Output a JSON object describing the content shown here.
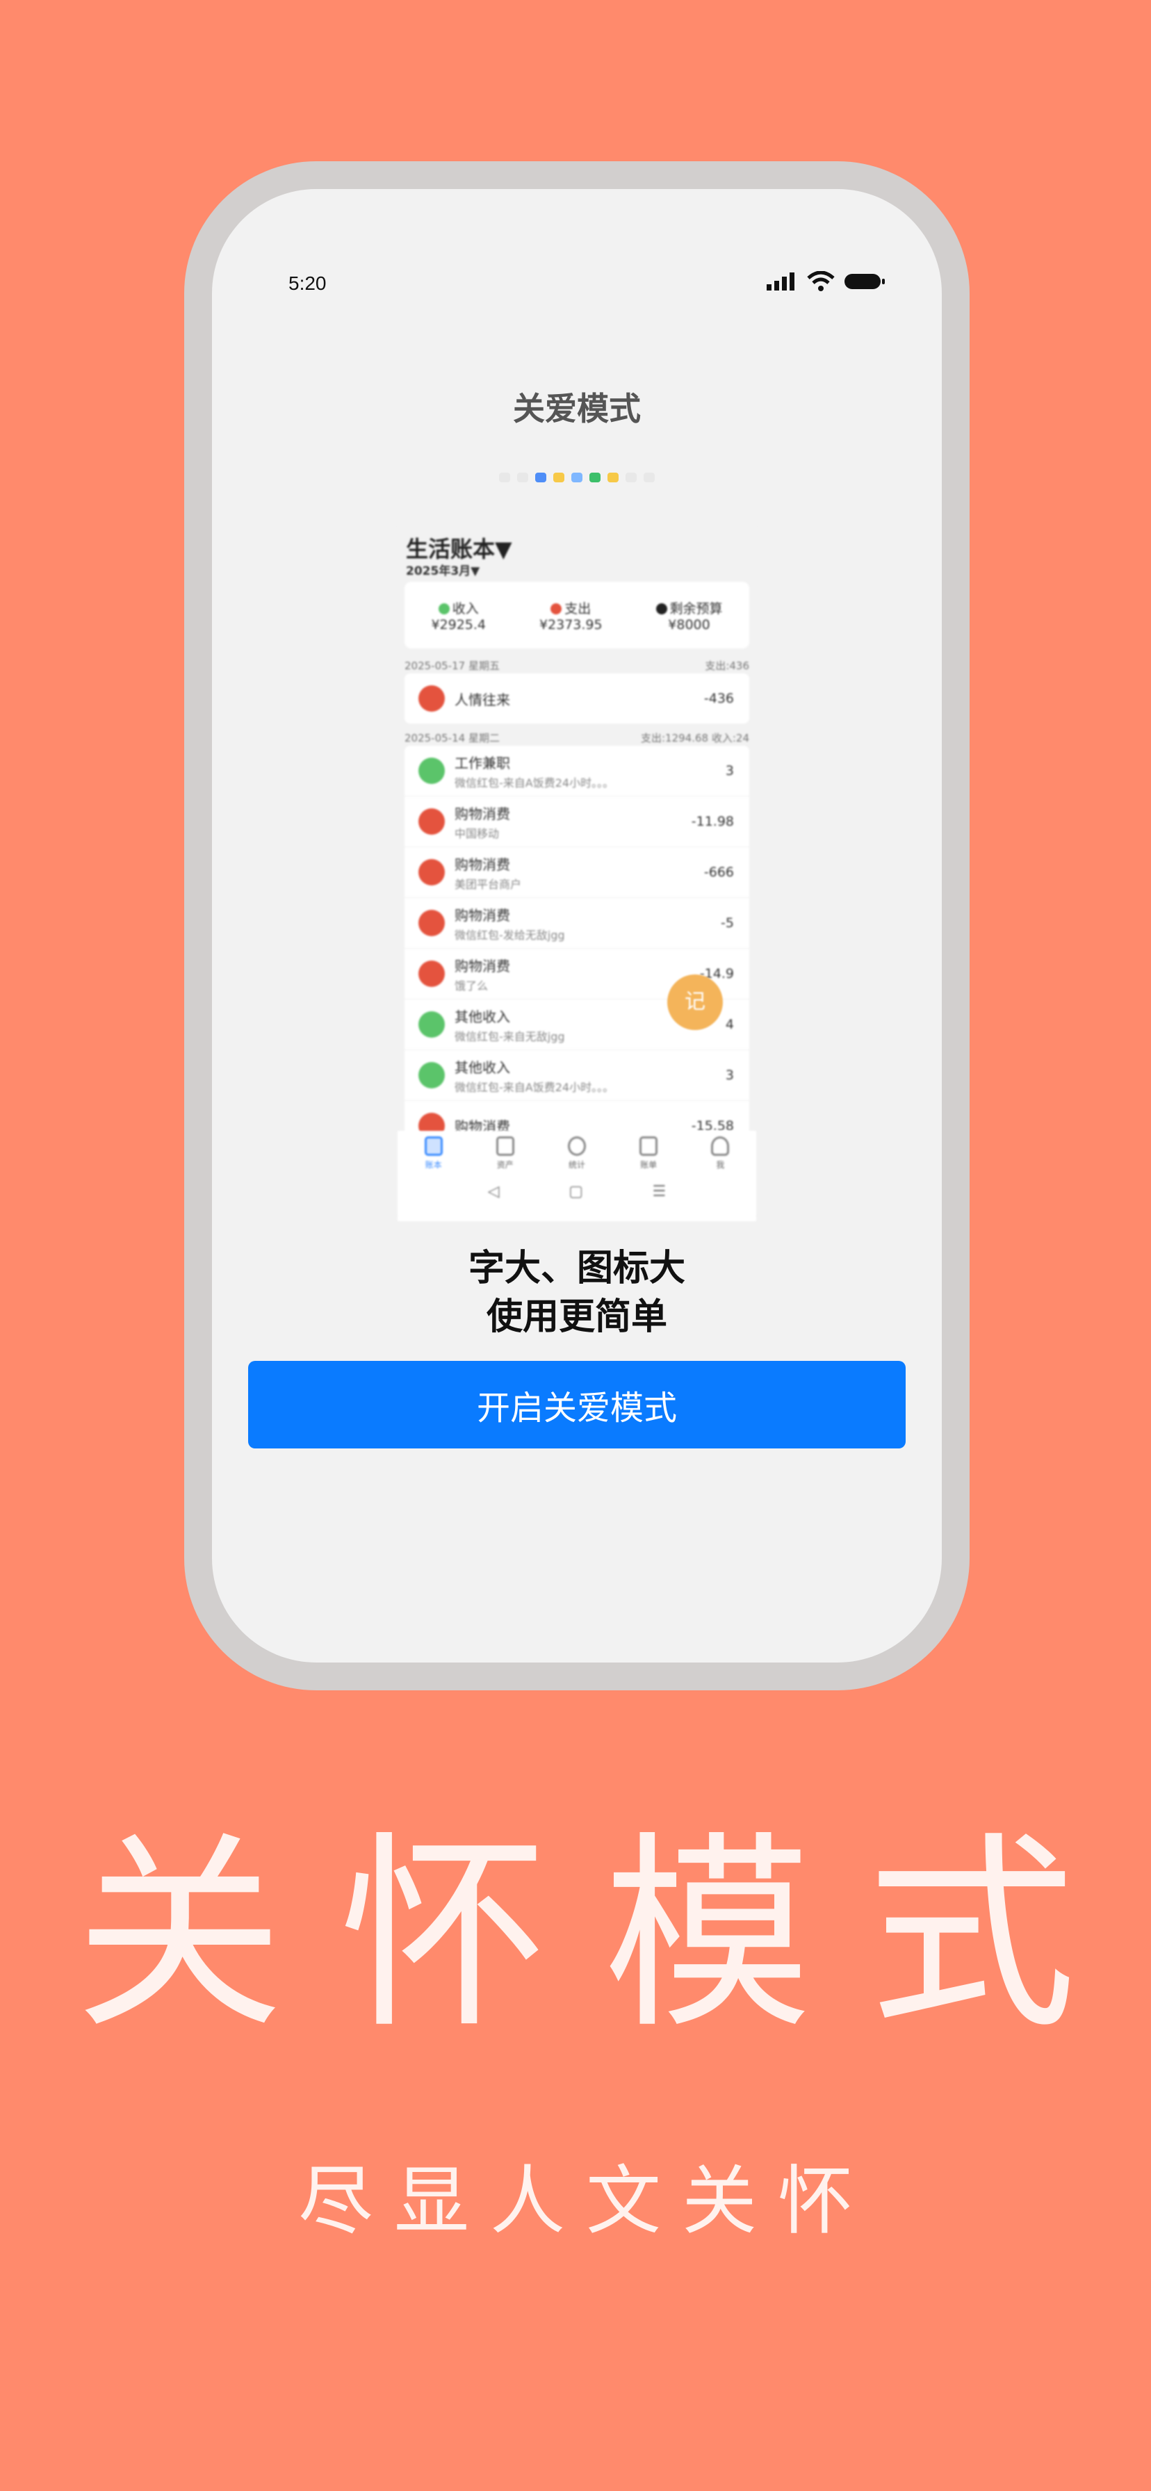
{
  "status_bar": {
    "time": "5:20"
  },
  "screen_title": "关爱模式",
  "preview": {
    "book_title": "生活账本▼",
    "month": "2025年3月▼",
    "summary": [
      {
        "label": "收入",
        "value": "¥2925.4",
        "color": "#5BC46A"
      },
      {
        "label": "支出",
        "value": "¥2373.95",
        "color": "#E4533E"
      },
      {
        "label": "剩余预算",
        "value": "¥8000",
        "color": "#222222"
      }
    ],
    "day1": {
      "date": "2025-05-17 星期五",
      "total": "支出:436"
    },
    "day1_rows": [
      {
        "category": "人情往来",
        "note": "",
        "amount": "-436",
        "color": "#E4533E"
      }
    ],
    "day2": {
      "date": "2025-05-14 星期二",
      "total": "支出:1294.68 收入:24"
    },
    "day2_rows": [
      {
        "category": "工作兼职",
        "note": "微信红包-来自A饭费24小时。。。",
        "amount": "3",
        "color": "#5BC46A"
      },
      {
        "category": "购物消费",
        "note": "中国移动",
        "amount": "-11.98",
        "color": "#E4533E"
      },
      {
        "category": "购物消费",
        "note": "美团平台商户",
        "amount": "-666",
        "color": "#E4533E"
      },
      {
        "category": "购物消费",
        "note": "微信红包-发给无敌jgg",
        "amount": "-5",
        "color": "#E4533E"
      },
      {
        "category": "购物消费",
        "note": "饿了么",
        "amount": "-14.9",
        "color": "#E4533E"
      },
      {
        "category": "其他收入",
        "note": "微信红包-来自无敌jgg",
        "amount": "4",
        "color": "#5BC46A"
      },
      {
        "category": "其他收入",
        "note": "微信红包-来自A饭费24小时。。。",
        "amount": "3",
        "color": "#5BC46A"
      },
      {
        "category": "购物消费",
        "note": "",
        "amount": "-15.58",
        "color": "#E4533E"
      }
    ],
    "fab_label": "记",
    "nav": [
      "账本",
      "资产",
      "统计",
      "账单",
      "我"
    ],
    "sysnav": [
      "◁",
      "▢",
      "☰"
    ]
  },
  "headline_line1": "字大、图标大",
  "headline_line2": "使用更简单",
  "cta_label": "开启关爱模式",
  "big_title": "关怀模式",
  "subtitle": "尽显人文关怀"
}
